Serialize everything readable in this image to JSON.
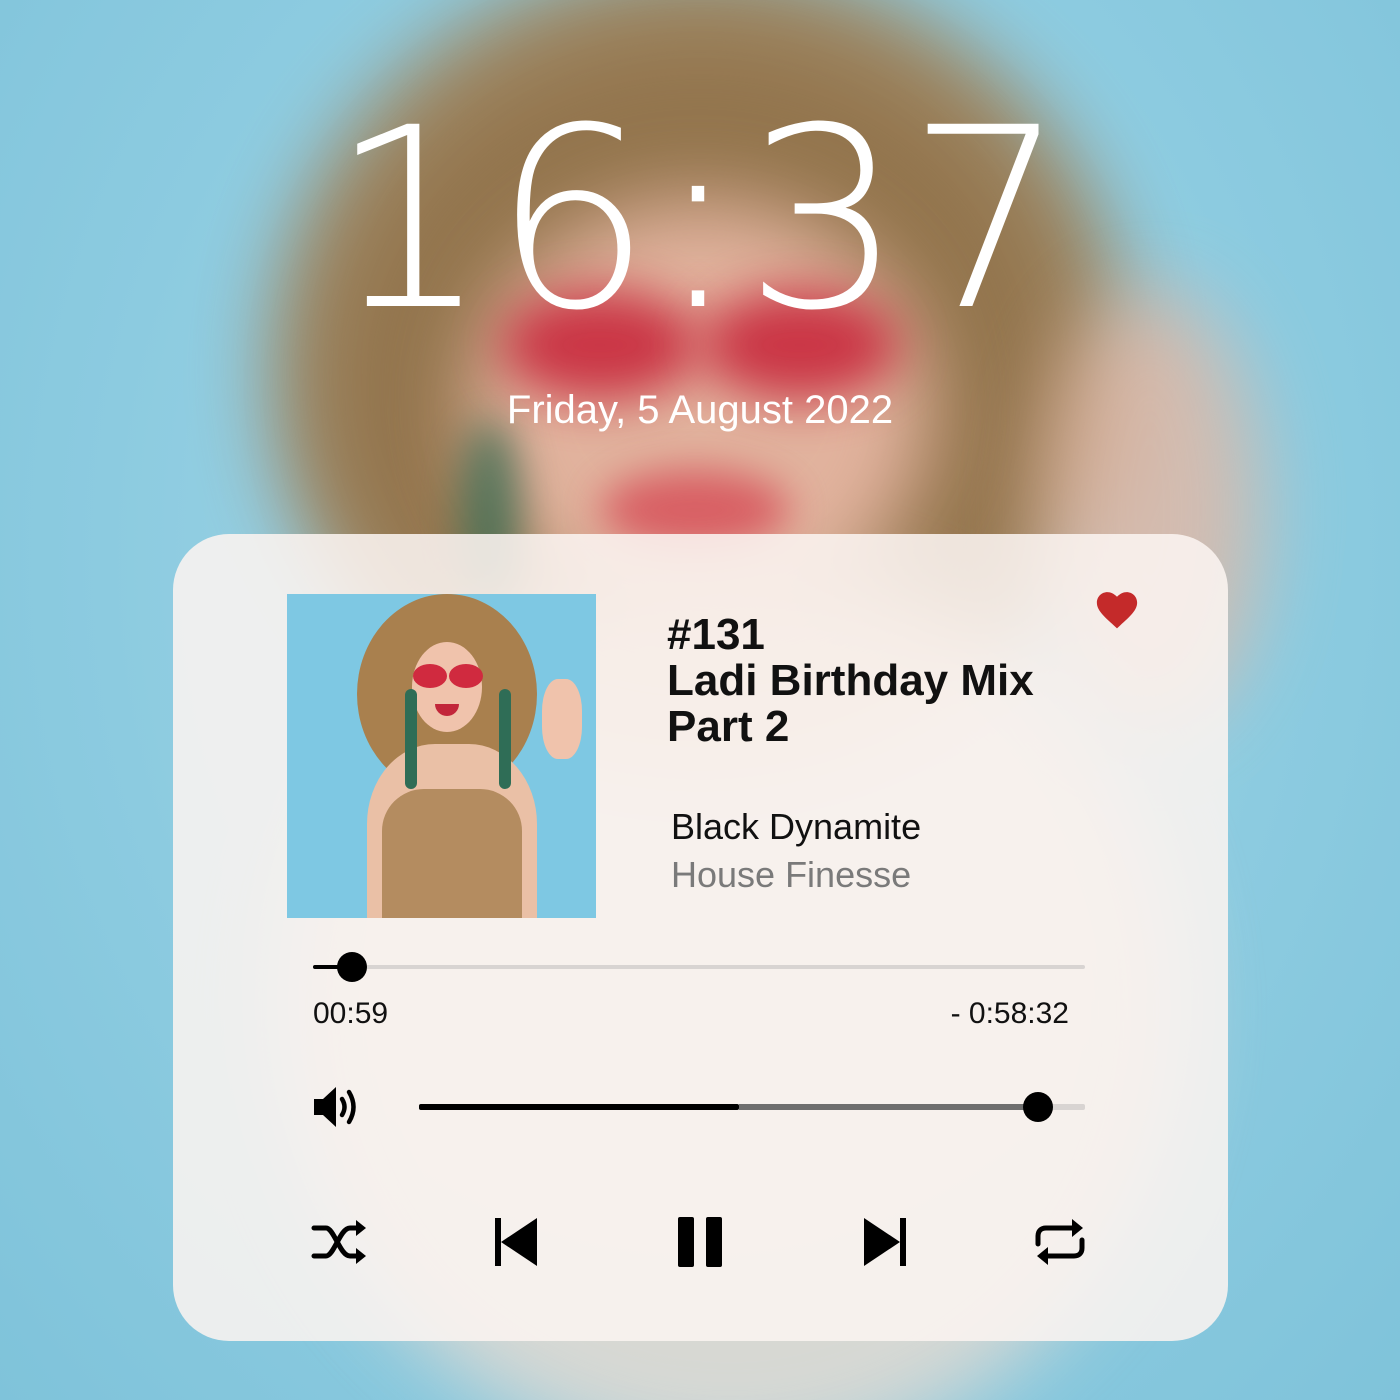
{
  "lock_screen": {
    "time": "16:37",
    "date": "Friday, 5 August 2022"
  },
  "player": {
    "track": {
      "number": "#131",
      "title_line1": "Ladi Birthday Mix",
      "title_line2": "Part 2",
      "artist": "Black Dynamite",
      "label": "House Finesse",
      "favorited": true
    },
    "progress": {
      "elapsed": "00:59",
      "remaining": "- 0:58:32",
      "fraction": 0.05
    },
    "volume": {
      "level": 0.93,
      "buffered": 0.48
    },
    "controls": {
      "icons": [
        "shuffle-icon",
        "previous-icon",
        "pause-icon",
        "next-icon",
        "repeat-icon"
      ]
    },
    "colors": {
      "heart": "#c42a2a",
      "accent": "#000000"
    }
  }
}
